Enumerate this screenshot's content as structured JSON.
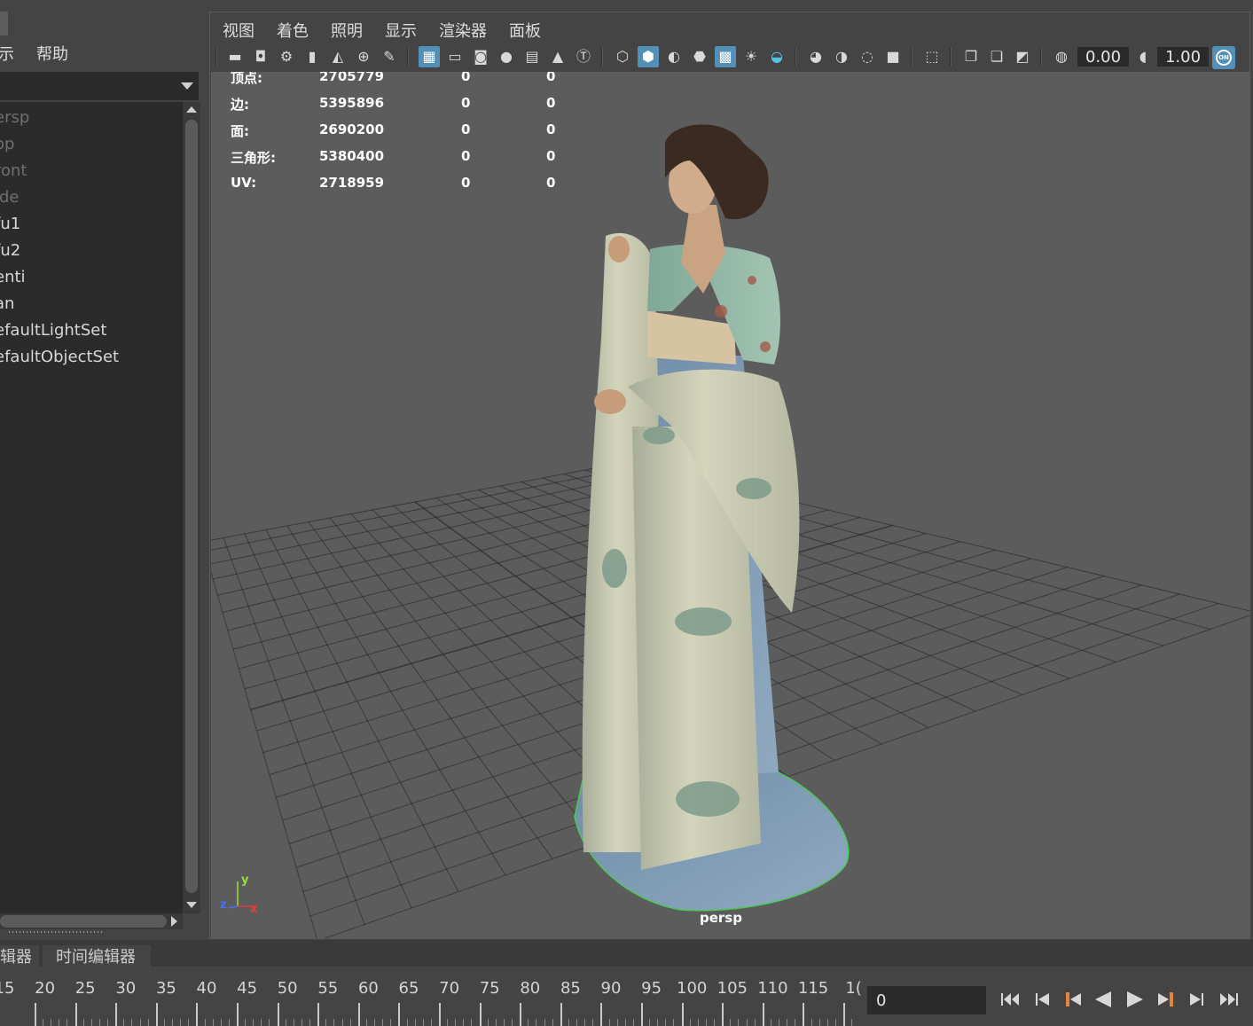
{
  "outliner": {
    "menu": [
      {
        "label": "示",
        "x": -2
      },
      {
        "label": "帮助",
        "x": 41
      }
    ],
    "items": [
      {
        "label": "ersp",
        "style": "dim"
      },
      {
        "label": "op",
        "style": "dim"
      },
      {
        "label": "ront",
        "style": "dim"
      },
      {
        "label": "ide",
        "style": "dim"
      },
      {
        "label": "fu1",
        "style": "lit"
      },
      {
        "label": "fu2",
        "style": "lit"
      },
      {
        "label": "enti",
        "style": "lit"
      },
      {
        "label": "an",
        "style": "lit"
      },
      {
        "label": "efaultLightSet",
        "style": "lit"
      },
      {
        "label": "efaultObjectSet",
        "style": "lit"
      }
    ]
  },
  "viewport_menu": [
    "视图",
    "着色",
    "照明",
    "显示",
    "渲染器",
    "面板"
  ],
  "toolbar": {
    "exposure": "0.00",
    "gamma": "1.00",
    "color_mgmt": "ON",
    "icons": [
      "camera-icon",
      "camera-lock-icon",
      "camera-attributes-icon",
      "bookmark-icon",
      "image-plane-icon",
      "2d-pan-zoom-icon",
      "grease-pencil-icon",
      "grid-icon",
      "film-gate-icon",
      "resolution-gate-icon",
      "gate-mask-icon",
      "field-chart-icon",
      "safe-action-icon",
      "safe-title-icon",
      "wireframe-icon",
      "smooth-shade-icon",
      "default-material-icon",
      "wireframe-on-shaded-icon",
      "textured-icon",
      "use-all-lights-icon",
      "shadows-icon",
      "screen-space-ao-icon",
      "motion-blur-icon",
      "anti-aliasing-icon",
      "depth-of-field-icon",
      "isolate-select-icon",
      "xray-icon",
      "xray-active-icon",
      "xray-joints-icon",
      "exposure-icon",
      "gamma-icon",
      "color-management-icon"
    ]
  },
  "hud": {
    "rows": [
      {
        "label": "顶点:",
        "v1": "2705779",
        "v2": "0",
        "v3": "0"
      },
      {
        "label": "边:",
        "v1": "5395896",
        "v2": "0",
        "v3": "0"
      },
      {
        "label": "面:",
        "v1": "2690200",
        "v2": "0",
        "v3": "0"
      },
      {
        "label": "三角形:",
        "v1": "5380400",
        "v2": "0",
        "v3": "0"
      },
      {
        "label": "UV:",
        "v1": "2718959",
        "v2": "0",
        "v3": "0"
      }
    ]
  },
  "camera_label": "persp",
  "axes": {
    "x": "x",
    "y": "y",
    "z": "z",
    "x_color": "#e83a3a",
    "y_color": "#9ade3c",
    "z_color": "#4a6cff"
  },
  "bottom_tabs": [
    "辑器",
    "时间编辑器"
  ],
  "timeline": {
    "ticks": [
      "15",
      "20",
      "25",
      "30",
      "35",
      "40",
      "45",
      "50",
      "55",
      "60",
      "65",
      "70",
      "75",
      "80",
      "85",
      "90",
      "95",
      "100",
      "105",
      "110",
      "115",
      "1("
    ],
    "current_frame": "0"
  },
  "playback": [
    "go-to-start-icon",
    "step-back-frame-icon",
    "step-back-key-icon",
    "play-backwards-icon",
    "play-forwards-icon",
    "step-forward-key-icon",
    "step-forward-frame-icon",
    "go-to-end-icon"
  ],
  "colors": {
    "accent": "#5390b8",
    "viewport_bg": "#5c5c5c",
    "key_marker": "#e8833a"
  }
}
